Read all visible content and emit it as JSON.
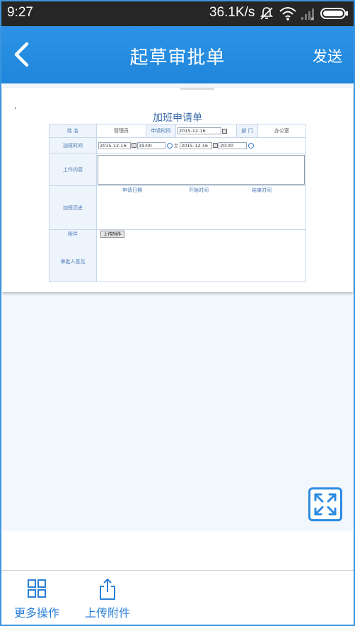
{
  "status_bar": {
    "time": "9:27",
    "network_speed": "36.1K/s",
    "icons": [
      "mute-icon",
      "wifi-icon",
      "signal-icon",
      "battery-icon"
    ]
  },
  "header": {
    "back_icon": "chevron-left-icon",
    "title": "起草审批单",
    "send_label": "发送"
  },
  "form": {
    "title": "加班申请单",
    "name_label": "姓 名",
    "name_value": "管理员",
    "apply_time_label": "申请时间",
    "apply_date": "2015-12-16",
    "dept_label": "部 门",
    "dept_value": "办公室",
    "overtime_label": "加班时间",
    "start_date": "2015-12-16",
    "start_time": "19:00",
    "to_label": "至",
    "end_date": "2015-12-16",
    "end_time": "20:00",
    "work_content_label": "工作内容",
    "history_label": "加班历史",
    "history_columns": [
      "申请日期",
      "开始时间",
      "结束时间"
    ],
    "attachment_label": "附件",
    "upload_button": "上传附件",
    "approver_label": "审批人意见"
  },
  "expand_icon": "fullscreen-expand-icon",
  "bottom_bar": {
    "more_label": "更多操作",
    "more_icon": "grid-icon",
    "upload_label": "上传附件",
    "upload_icon": "share-upload-icon"
  },
  "colors": {
    "accent": "#2289dd",
    "status_bar": "#262626",
    "content_bg": "#f2f7fd"
  }
}
